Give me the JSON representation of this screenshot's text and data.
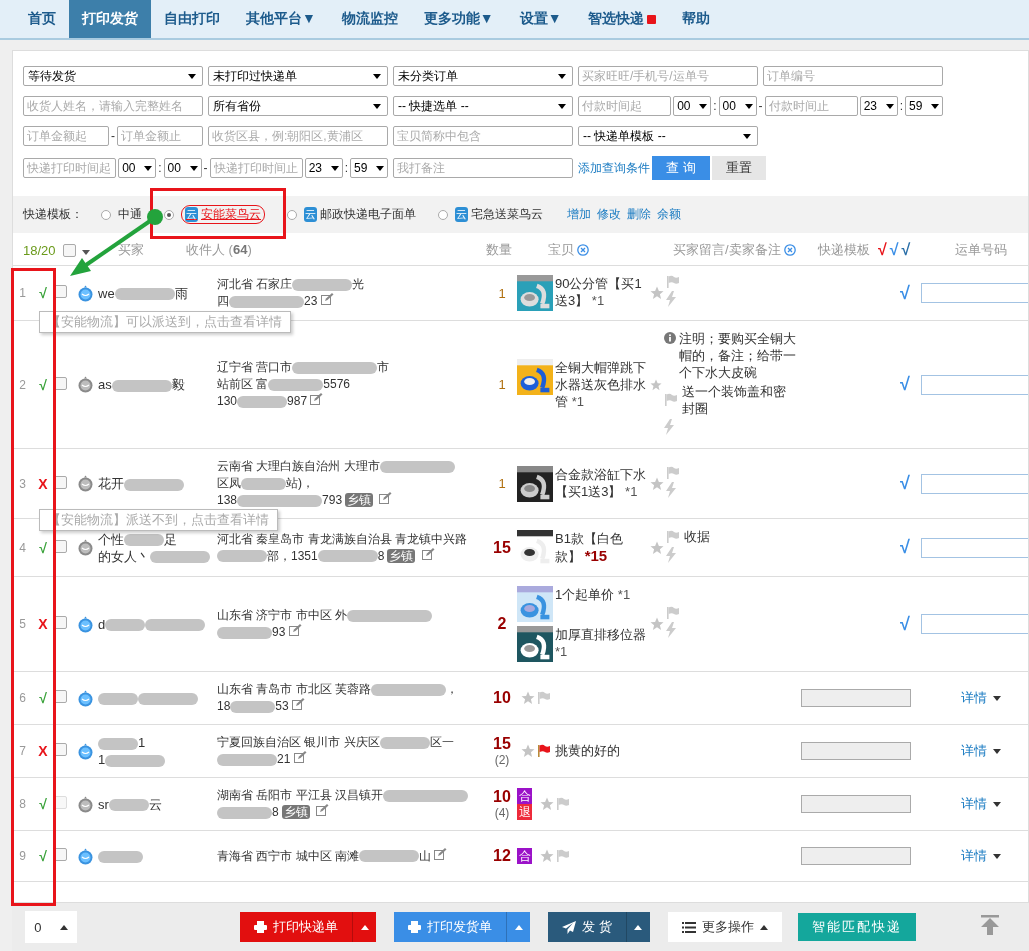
{
  "nav": {
    "items": [
      {
        "label": "首页",
        "selected": false,
        "badge": false
      },
      {
        "label": "打印发货",
        "selected": true,
        "badge": false
      },
      {
        "label": "自由打印",
        "selected": false,
        "badge": false
      },
      {
        "label": "其他平台▼",
        "selected": false,
        "badge": false
      },
      {
        "label": "物流监控",
        "selected": false,
        "badge": false
      },
      {
        "label": "更多功能▼",
        "selected": false,
        "badge": false
      },
      {
        "label": "设置▼",
        "selected": false,
        "badge": false
      },
      {
        "label": "智选快递",
        "selected": false,
        "badge": true
      },
      {
        "label": "帮助",
        "selected": false,
        "badge": false
      }
    ]
  },
  "filters": {
    "rows": [
      [
        {
          "fields": [
            {
              "kind": "select",
              "value": "等待发货"
            }
          ]
        },
        {
          "fields": [
            {
              "kind": "select",
              "value": "未打印过快递单"
            }
          ]
        },
        {
          "fields": [
            {
              "kind": "select",
              "value": "未分类订单"
            }
          ]
        },
        {
          "fields": [
            {
              "kind": "input",
              "placeholder": "买家旺旺/手机号/运单号"
            }
          ]
        },
        {
          "fields": [
            {
              "kind": "input",
              "placeholder": "订单编号"
            }
          ]
        }
      ],
      [
        {
          "fields": [
            {
              "kind": "input",
              "placeholder": "收货人姓名，请输入完整姓名"
            }
          ]
        },
        {
          "fields": [
            {
              "kind": "select",
              "value": "所有省份"
            }
          ]
        },
        {
          "fields": [
            {
              "kind": "select",
              "value": "-- 快捷选单 --"
            }
          ]
        },
        {
          "colspan": 2,
          "fields": [
            {
              "kind": "input",
              "placeholder": "付款时间起"
            },
            {
              "kind": "time",
              "value": "00"
            },
            {
              "kind": "sep",
              "text": ":"
            },
            {
              "kind": "time",
              "value": "00"
            },
            {
              "kind": "sep",
              "text": "-"
            },
            {
              "kind": "input",
              "placeholder": "付款时间止"
            },
            {
              "kind": "time",
              "value": "23"
            },
            {
              "kind": "sep",
              "text": ":"
            },
            {
              "kind": "time",
              "value": "59"
            }
          ]
        }
      ],
      [
        {
          "fields": [
            {
              "kind": "input",
              "placeholder": "订单金额起"
            },
            {
              "kind": "sep",
              "text": "-"
            },
            {
              "kind": "input",
              "placeholder": "订单金额止"
            }
          ]
        },
        {
          "fields": [
            {
              "kind": "input",
              "placeholder": "收货区县，例:朝阳区,黄浦区"
            }
          ]
        },
        {
          "fields": [
            {
              "kind": "input",
              "placeholder": "宝贝简称中包含"
            }
          ]
        },
        {
          "fields": [
            {
              "kind": "select",
              "value": "-- 快递单模板 --"
            }
          ]
        }
      ],
      [
        {
          "colspan": 2,
          "fields": [
            {
              "kind": "input",
              "placeholder": "快递打印时间起"
            },
            {
              "kind": "time",
              "value": "00"
            },
            {
              "kind": "sep",
              "text": ":"
            },
            {
              "kind": "time",
              "value": "00"
            },
            {
              "kind": "sep",
              "text": "-"
            },
            {
              "kind": "input",
              "placeholder": "快递打印时间止"
            },
            {
              "kind": "time",
              "value": "23"
            },
            {
              "kind": "sep",
              "text": ":"
            },
            {
              "kind": "time",
              "value": "59"
            }
          ]
        },
        {
          "fields": [
            {
              "kind": "input",
              "placeholder": "我打备注"
            }
          ]
        },
        {
          "fields": [
            {
              "kind": "link",
              "text": "添加查询条件"
            },
            {
              "kind": "primary",
              "text": "查 询"
            },
            {
              "kind": "button",
              "text": "重置"
            }
          ]
        }
      ]
    ]
  },
  "template_bar": {
    "label": "快递模板：",
    "options": [
      {
        "label": "中通",
        "selected": false
      },
      {
        "label": "安能菜鸟云",
        "selected": true,
        "tag": "云"
      },
      {
        "label": "邮政快递电子面单",
        "selected": false,
        "tag": "云"
      },
      {
        "label": "宅急送菜鸟云",
        "selected": false,
        "tag": "云"
      }
    ],
    "links": [
      "增加",
      "修改",
      "删除",
      "余额"
    ]
  },
  "table": {
    "header": {
      "count": "18/20",
      "select_all": {
        "checked": false
      },
      "columns": [
        {
          "label": "买家",
          "removable": false
        },
        {
          "label": "收件人 (**64**)",
          "removable": false
        },
        {
          "label": "数量",
          "removable": false
        },
        {
          "label": "宝贝",
          "removable": true
        },
        {
          "label": "买家留言/卖家备注",
          "removable": true
        },
        {
          "label": "快递模板",
          "removable": false
        }
      ],
      "checks": [
        {
          "mark": "√",
          "color": "#e8141a"
        },
        {
          "mark": "√",
          "color": "#3a8ee6"
        },
        {
          "mark": "√",
          "color": "#2a6fa8"
        }
      ],
      "last_column": "运单号码"
    },
    "rows": [
      {
        "index": "1",
        "kind": "editable",
        "status": {
          "mark": "√",
          "ok": true
        },
        "checkbox": {
          "checked": false,
          "disabled": false
        },
        "buyer": {
          "online": true,
          "lines": [
            [
              {
                "text": "we"
              },
              {
                "redacted": true
              },
              {
                "text": "雨"
              }
            ]
          ]
        },
        "address": {
          "lines": [
            [
              {
                "text": "河北省 石家庄"
              },
              {
                "redacted": true
              },
              {
                "text": "光"
              }
            ],
            [
              {
                "text": "四"
              },
              {
                "redacted": true
              },
              {
                "text": "23"
              }
            ]
          ]
        },
        "qty": "1",
        "multi": false,
        "items": [
          {
            "title": "90公分管【买1送3】",
            "count": "*1",
            "highlight": false
          }
        ],
        "memo": {
          "flagged": false
        },
        "template": "√",
        "tooltip": "【安能物流】可以派送到，点击查看详情"
      },
      {
        "index": "2",
        "kind": "editable",
        "status": {
          "mark": "√",
          "ok": true
        },
        "checkbox": {
          "checked": false,
          "disabled": false
        },
        "buyer": {
          "online": false,
          "lines": [
            [
              {
                "text": "as"
              },
              {
                "redacted": true
              },
              {
                "text": "毅"
              }
            ]
          ]
        },
        "address": {
          "lines": [
            [
              {
                "text": "辽宁省 营口市"
              },
              {
                "redacted": true
              },
              {
                "text": "市"
              }
            ],
            [
              {
                "text": "站前区 富"
              },
              {
                "redacted": true
              },
              {
                "text": "5576"
              }
            ],
            [
              {
                "text": "130"
              },
              {
                "redacted": true
              },
              {
                "text": "987"
              }
            ]
          ]
        },
        "qty": "1",
        "multi": false,
        "items": [
          {
            "title": "全铜大帽弹跳下水器送灰色排水管",
            "count": "*1",
            "highlight": false
          }
        ],
        "memo": {
          "message": "注明；要购买全铜大帽的，备注；给带一个下水大皮碗",
          "note": "送一个装饰盖和密封圈",
          "flagged": false
        },
        "template": "√"
      },
      {
        "index": "3",
        "kind": "editable",
        "status": {
          "mark": "X",
          "ok": false
        },
        "checkbox": {
          "checked": false,
          "disabled": false
        },
        "buyer": {
          "online": false,
          "lines": [
            [
              {
                "text": "花开"
              },
              {
                "redacted": true
              }
            ]
          ]
        },
        "address": {
          "lines": [
            [
              {
                "text": "云南省 大理白族自治州 大理市"
              },
              {
                "redacted": true
              }
            ],
            [
              {
                "text": "区凤"
              },
              {
                "redacted": true
              },
              {
                "text": "站)，"
              }
            ],
            [
              {
                "text": "138"
              },
              {
                "redacted": true
              },
              {
                "text": "793"
              }
            ]
          ],
          "tag": "乡镇"
        },
        "qty": "1",
        "multi": false,
        "items": [
          {
            "title": "合金款浴缸下水【买1送3】",
            "count": "*1",
            "highlight": false
          }
        ],
        "memo": {
          "flagged": false
        },
        "template": "√",
        "tooltip": "【安能物流】派送不到，点击查看详情"
      },
      {
        "index": "4",
        "kind": "editable",
        "status": {
          "mark": "√",
          "ok": true
        },
        "checkbox": {
          "checked": false,
          "disabled": false
        },
        "buyer": {
          "online": false,
          "lines": [
            [
              {
                "text": "个性"
              },
              {
                "redacted": true
              },
              {
                "text": "足"
              }
            ],
            [
              {
                "text": "的女人丶"
              },
              {
                "redacted": true
              }
            ]
          ]
        },
        "address": {
          "lines": [
            [
              {
                "text": "河北省 秦皇岛市 青龙满族自治县 青龙镇中兴路"
              }
            ],
            [
              {
                "redacted": true
              },
              {
                "text": "部，1351"
              },
              {
                "redacted": true
              },
              {
                "text": "8"
              }
            ]
          ],
          "tag": "乡镇"
        },
        "qty": "15",
        "multi": true,
        "items": [
          {
            "title": "B1款【白色款】",
            "count": "*15",
            "highlight": true
          }
        ],
        "memo": {
          "note": "收据",
          "flagged": false
        },
        "template": "√"
      },
      {
        "index": "5",
        "kind": "editable",
        "status": {
          "mark": "X",
          "ok": false
        },
        "checkbox": {
          "checked": false,
          "disabled": false
        },
        "buyer": {
          "online": true,
          "lines": [
            [
              {
                "text": "d"
              },
              {
                "redacted": true
              },
              {
                "redacted": true
              }
            ]
          ]
        },
        "address": {
          "lines": [
            [
              {
                "text": "山东省 济宁市 市中区 外"
              },
              {
                "redacted": true
              }
            ],
            [
              {
                "redacted": true
              },
              {
                "text": "93"
              }
            ]
          ]
        },
        "qty": "2",
        "multi": true,
        "items": [
          {
            "title": "1个起单价",
            "count": "*1",
            "highlight": false
          },
          {
            "title": "加厚直排移位器",
            "count": "*1",
            "highlight": false
          }
        ],
        "memo": {
          "flagged": false
        },
        "template": "√"
      },
      {
        "index": "6",
        "kind": "assigned",
        "status": {
          "mark": "√",
          "ok": true
        },
        "checkbox": {
          "checked": false,
          "disabled": false
        },
        "buyer": {
          "online": true,
          "lines": [
            [
              {
                "redacted": true
              },
              {
                "redacted": true
              }
            ]
          ]
        },
        "address": {
          "lines": [
            [
              {
                "text": "山东省 青岛市 市北区 芙蓉路"
              },
              {
                "redacted": true
              },
              {
                "text": "，"
              }
            ],
            [
              {
                "text": "18"
              },
              {
                "redacted": true
              },
              {
                "text": "53"
              }
            ]
          ]
        },
        "qty": "10",
        "multi": true,
        "items": [],
        "memo": {
          "flagged": false
        },
        "detail": "详情"
      },
      {
        "index": "7",
        "kind": "assigned",
        "status": {
          "mark": "X",
          "ok": false
        },
        "checkbox": {
          "checked": false,
          "disabled": false
        },
        "buyer": {
          "online": true,
          "lines": [
            [
              {
                "redacted": true
              },
              {
                "text": "1"
              }
            ],
            [
              {
                "text": "1"
              },
              {
                "redacted": true
              }
            ]
          ]
        },
        "address": {
          "lines": [
            [
              {
                "text": "宁夏回族自治区 银川市 兴庆区"
              },
              {
                "redacted": true
              },
              {
                "text": "区一"
              }
            ],
            [
              {
                "redacted": true
              },
              {
                "text": "21"
              }
            ]
          ]
        },
        "qty": "15",
        "qty_note": "(2)",
        "multi": true,
        "items": [],
        "memo": {
          "note": "挑黄的好的",
          "flagged": true
        },
        "detail": "详情"
      },
      {
        "index": "8",
        "kind": "assigned",
        "status": {
          "mark": "√",
          "ok": true
        },
        "checkbox": {
          "checked": false,
          "disabled": true
        },
        "buyer": {
          "online": false,
          "lines": [
            [
              {
                "text": "sr"
              },
              {
                "redacted": true
              },
              {
                "text": "云"
              }
            ]
          ]
        },
        "address": {
          "lines": [
            [
              {
                "text": "湖南省 岳阳市 平江县 汉昌镇开"
              },
              {
                "redacted": true
              }
            ],
            [
              {
                "redacted": true
              },
              {
                "text": "8"
              }
            ]
          ],
          "tag": "乡镇"
        },
        "qty": "10",
        "qty_note": "(4)",
        "multi": true,
        "tags": [
          {
            "text": "合",
            "color": "#9b12c8"
          },
          {
            "text": "退",
            "color": "#ee2a3a"
          }
        ],
        "items": [],
        "memo": {
          "flagged": false
        },
        "detail": "详情"
      },
      {
        "index": "9",
        "kind": "assigned",
        "status": {
          "mark": "√",
          "ok": true
        },
        "checkbox": {
          "checked": false,
          "disabled": false
        },
        "buyer": {
          "online": true,
          "lines": [
            [
              {
                "redacted": true
              }
            ]
          ]
        },
        "address": {
          "lines": [
            [
              {
                "text": "青海省 西宁市 城中区 南滩"
              },
              {
                "redacted": true
              },
              {
                "text": "山"
              }
            ]
          ]
        },
        "qty": "12",
        "multi": true,
        "tags": [
          {
            "text": "合",
            "color": "#9b12c8"
          }
        ],
        "items": [],
        "memo": {
          "flagged": false
        },
        "detail": "详情"
      }
    ]
  },
  "footer": {
    "count": "0",
    "buttons": [
      {
        "kind": "red",
        "label": "打印快递单"
      },
      {
        "kind": "blue",
        "label": "打印发货单"
      },
      {
        "kind": "dark",
        "label": "发 货"
      },
      {
        "kind": "plain",
        "label": "更多操作"
      },
      {
        "kind": "teal",
        "label": "智能匹配快递"
      }
    ]
  }
}
